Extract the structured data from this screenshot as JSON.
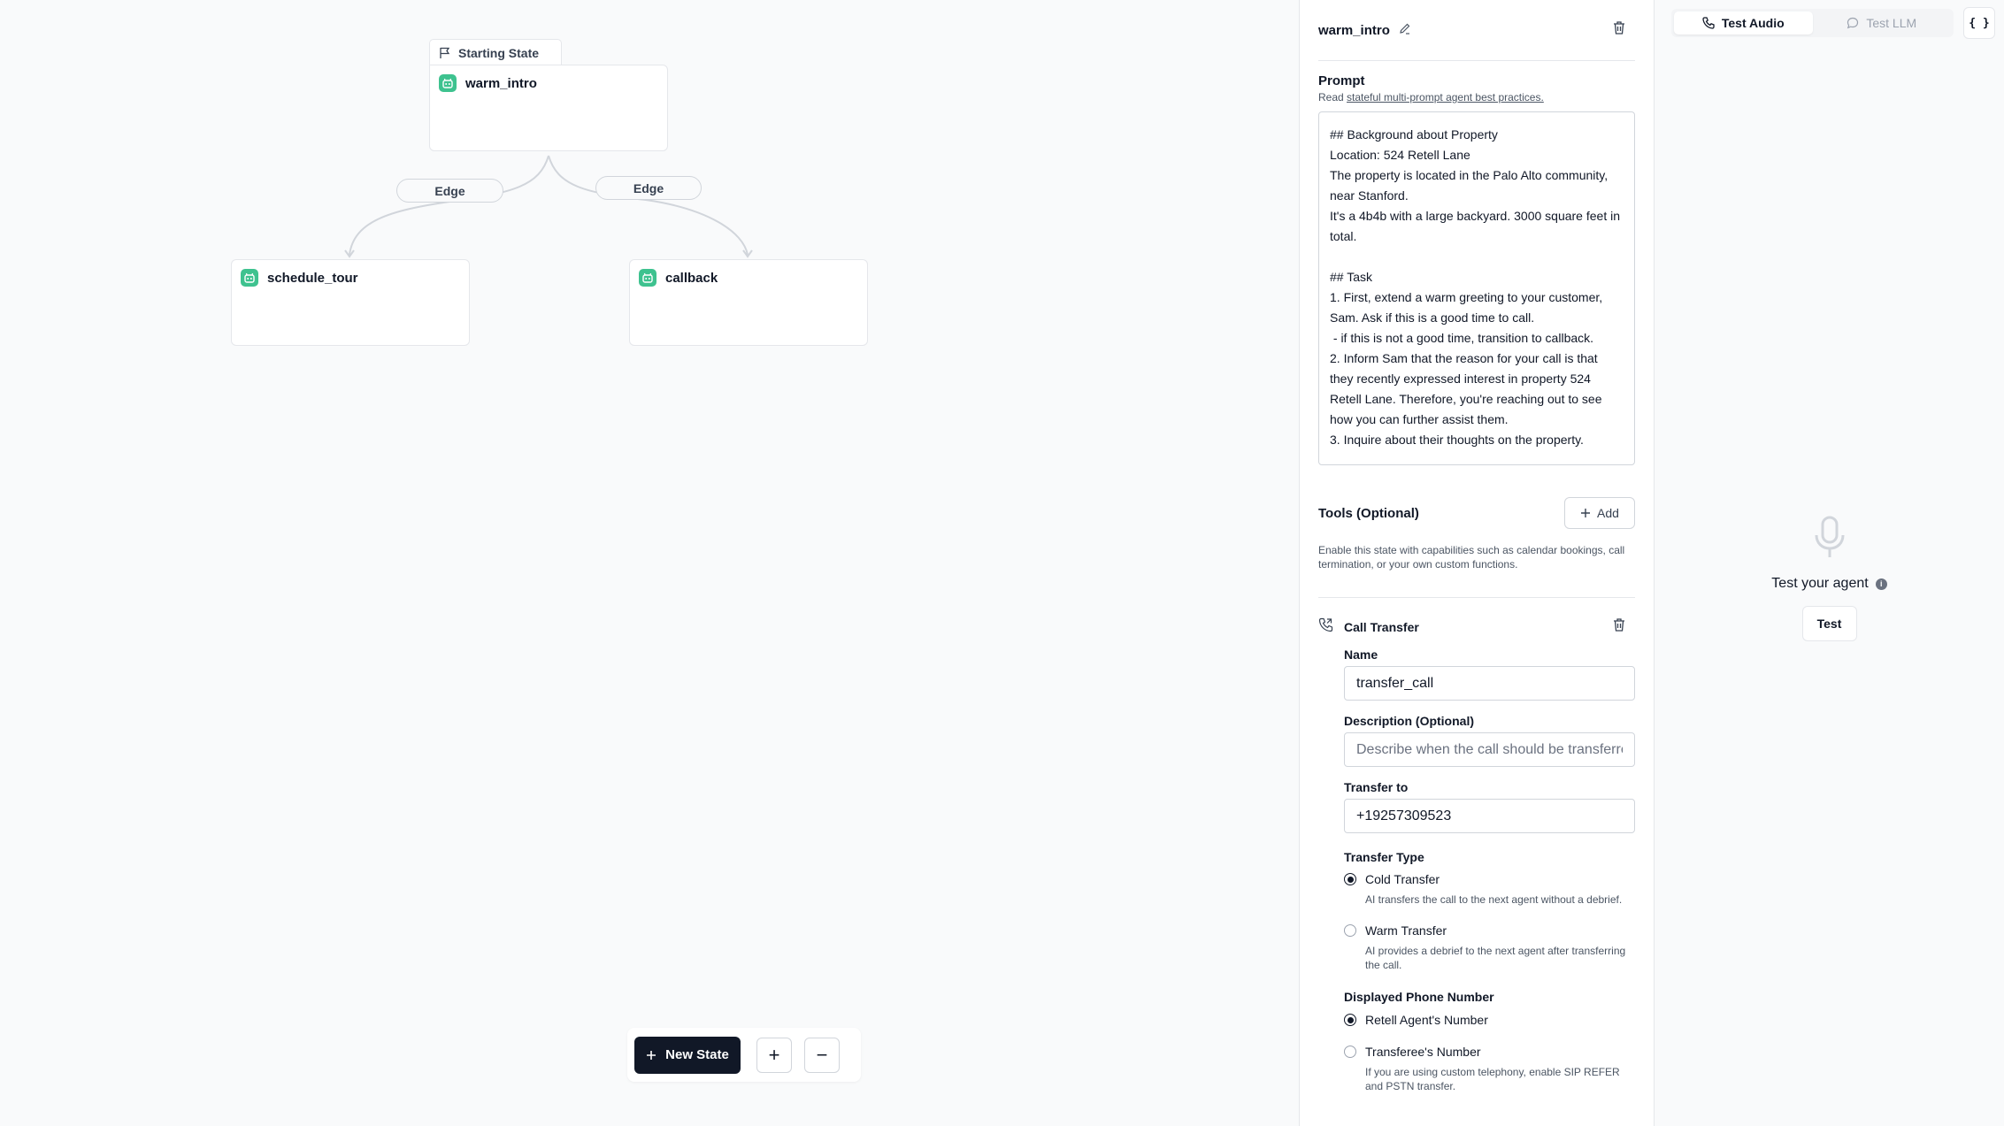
{
  "canvas": {
    "start_tag": "Starting State",
    "nodes": [
      {
        "label": "warm_intro"
      },
      {
        "label": "schedule_tour"
      },
      {
        "label": "callback"
      }
    ],
    "edges": [
      {
        "label": "Edge"
      },
      {
        "label": "Edge"
      }
    ],
    "toolbar": {
      "new_state": "New State",
      "zoom_in": "+",
      "zoom_out": "−"
    }
  },
  "state_panel": {
    "title": "warm_intro",
    "prompt": {
      "label": "Prompt",
      "sub_prefix": "Read ",
      "sub_link": "stateful multi-prompt agent best practices.",
      "text": "## Background about Property\nLocation: 524 Retell Lane\nThe property is located in the Palo Alto community,\nnear Stanford.\nIt's a 4b4b with a large backyard. 3000 square feet in\ntotal.\n\n## Task\n1. First, extend a warm greeting to your customer,\nSam. Ask if this is a good time to call.\n - if this is not a good time, transition to callback.\n2. Inform Sam that the reason for your call is that\nthey recently expressed interest in property 524\nRetell Lane. Therefore, you're reaching out to see\nhow you can further assist them.\n3. Inquire about their thoughts on the property."
    },
    "tools": {
      "label": "Tools (Optional)",
      "add_label": "Add",
      "description": "Enable this state with capabilities such as calendar bookings, call termination, or your own custom functions."
    },
    "call_transfer": {
      "title": "Call Transfer",
      "name_label": "Name",
      "name_value": "transfer_call",
      "description_label": "Description (Optional)",
      "description_placeholder": "Describe when the call should be transferred",
      "transfer_to_label": "Transfer to",
      "transfer_to_value": "+19257309523",
      "transfer_type_label": "Transfer Type",
      "transfer_types": [
        {
          "label": "Cold Transfer",
          "desc": "AI transfers the call to the next agent without a debrief.",
          "selected": true
        },
        {
          "label": "Warm Transfer",
          "desc": "AI provides a debrief to the next agent after transferring the call.",
          "selected": false
        }
      ],
      "displayed_number_label": "Displayed Phone Number",
      "displayed_numbers": [
        {
          "label": "Retell Agent's Number",
          "selected": true
        },
        {
          "label": "Transferee's Number",
          "desc": "If you are using custom telephony, enable SIP REFER and PSTN transfer.",
          "selected": false
        }
      ]
    }
  },
  "test_panel": {
    "tabs": [
      {
        "label": "Test Audio",
        "active": true
      },
      {
        "label": "Test LLM",
        "active": false
      }
    ],
    "json_button": "{ }",
    "title": "Test your agent",
    "info": "i",
    "button": "Test"
  },
  "colors": {
    "node_icon": "#3ec28f",
    "primary": "#111827"
  }
}
